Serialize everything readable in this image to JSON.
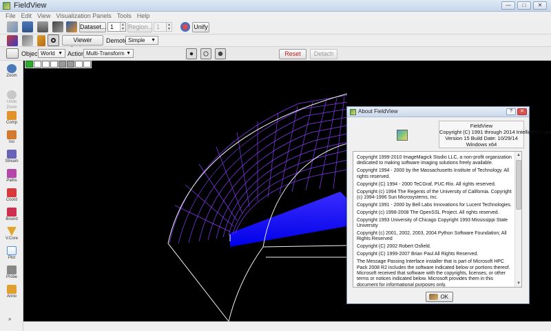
{
  "window": {
    "title": "FieldView"
  },
  "menu": [
    "File",
    "Edit",
    "View",
    "Visualization Panels",
    "Tools",
    "Help"
  ],
  "toolbar1": {
    "dataset_label": "Dataset...",
    "dataset_value": "1",
    "region_label": "Region...",
    "region_value": "1",
    "unify_label": "Unify"
  },
  "toolbar2": {
    "viewer_options_label": "Viewer Options...",
    "demote_label": "Demote:",
    "demote_value": "Simple"
  },
  "toolbar3": {
    "object_label": "Object:",
    "object_value": "World",
    "action_label": "Action:",
    "action_value": "Multi-Transform",
    "reset_label": "Reset",
    "detach_label": "Detach"
  },
  "left_tools": [
    {
      "label": "Zoom",
      "icon": "zoom-icon",
      "color": "#4a78b8",
      "enabled": true
    },
    {
      "label": "Undo Zoom",
      "icon": "undo-zoom-icon",
      "color": "#b8b8b8",
      "enabled": false
    },
    {
      "label": "Comp",
      "icon": "comp-icon",
      "color": "#e0922b",
      "enabled": true
    },
    {
      "label": "Iso",
      "icon": "iso-icon",
      "color": "#d17a2e",
      "enabled": true
    },
    {
      "label": "Stream",
      "icon": "stream-icon",
      "color": "#6a63b8",
      "enabled": true
    },
    {
      "label": "Paths",
      "icon": "paths-icon",
      "color": "#b348a8",
      "enabled": true
    },
    {
      "label": "Coord",
      "icon": "coord-icon",
      "color": "#d63a3a",
      "enabled": true
    },
    {
      "label": "Bound",
      "icon": "bound-icon",
      "color": "#cf2f4f",
      "enabled": true
    },
    {
      "label": "V.Core",
      "icon": "vcore-icon",
      "color": "#e0a52b",
      "enabled": true
    },
    {
      "label": "Plot",
      "icon": "plot-icon",
      "color": "#4f8ed0",
      "enabled": true
    },
    {
      "label": "Probe",
      "icon": "probe-icon",
      "color": "#888888",
      "enabled": true
    },
    {
      "label": "Anno",
      "icon": "anno-icon",
      "color": "#e0a030",
      "enabled": true
    }
  ],
  "about": {
    "title": "About FieldView",
    "product": "FieldView",
    "copyright": "Copyright (C) 1991 through 2014 Intelligent Light",
    "version": "Version 15  Build Date: 10/29/14",
    "platform": "Windows x64",
    "notices": [
      "Copyright 1999-2010 ImageMagick Studio LLC, a non-profit organization dedicated to making software imaging solutions freely available.",
      "Copyright 1994 - 2000 by the Massachusetts Institute of Technology.  All rights reserved.",
      "Copyright (C) 1994 - 2000 TeCGraf, PUC-Rio.  All rights reserved.",
      "Copyright (c) 1994 The Regents of the University of California. Copyright (c) 1994-1996 Sun Microsystems, Inc.",
      "Copyright 1991 - 2000 by Bell Labs Innovations for Lucent Technologies.",
      "Copyright (c) 1998-2008 The OpenSSL Project.  All rights reserved.",
      "Copyright 1993 University of Chicago Copyright 1993 Mississippi State University",
      "Copyright (c) 2001, 2002, 2003, 2004 Python Software Foundation; All Rights Reserved",
      "Copyright (C) 2002 Robert Osfield.",
      "Copyright (C) 1999-2007  Brian Paul   All Rights Reserved.",
      "The Message Passing Interface installer that is part of Microsoft HPC Pack 2008 R2 includes the software indicated below or portions thereof.  Microsoft received that software with the copyrights, licenses, or other terms or notices indicated below.  Microsoft provides them in this document for informational purposes only."
    ],
    "ok_label": "OK"
  },
  "colors": {
    "viewport_bg": "#000000",
    "mesh_purple": "#8a3cff",
    "surface_blue": "#1010ff",
    "outline": "#f2f2f2"
  }
}
